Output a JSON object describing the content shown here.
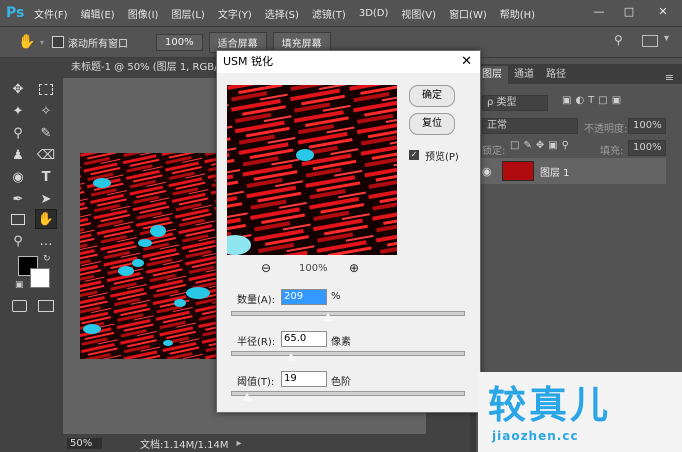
{
  "app": {
    "logo": "Ps",
    "menu": [
      "文件(F)",
      "编辑(E)",
      "图像(I)",
      "图层(L)",
      "文字(Y)",
      "选择(S)",
      "滤镜(T)",
      "3D(D)",
      "视图(V)",
      "窗口(W)",
      "帮助(H)"
    ],
    "window_controls": [
      "minimize-icon",
      "maximize-icon",
      "close-icon"
    ]
  },
  "options_bar": {
    "tool_icon": "hand-icon",
    "scroll_all_label": "滚动所有窗口",
    "scroll_all_checked": false,
    "zoom_btn": "100%",
    "fit_btn": "适合屏幕",
    "fill_btn": "填充屏幕"
  },
  "document": {
    "tab_title": "未标题-1 @ 50% (图层 1, RGB/8",
    "zoom": "50%",
    "doc_info": "文档:1.14M/1.14M"
  },
  "layers_panel": {
    "tabs": [
      "图层",
      "通道",
      "路径"
    ],
    "active_tab": "图层",
    "kind_filter": "ρ 类型",
    "blend_mode": "正常",
    "opacity_label": "不透明度:",
    "opacity_value": "100%",
    "lock_label": "锁定:",
    "fill_label": "填充:",
    "fill_value": "100%",
    "layers": [
      {
        "name": "图层 1",
        "visible": true
      }
    ]
  },
  "dialog": {
    "title": "USM 锐化",
    "ok_label": "确定",
    "reset_label": "复位",
    "preview_label": "预览(P)",
    "preview_checked": true,
    "zoom_label": "100%",
    "amount_label": "数量(A):",
    "amount_value": "209",
    "amount_unit": "%",
    "amount_fraction": 0.42,
    "radius_label": "半径(R):",
    "radius_value": "65.0",
    "radius_unit": "像素",
    "radius_fraction": 0.26,
    "threshold_label": "阈值(T):",
    "threshold_value": "19",
    "threshold_unit": "色阶",
    "threshold_fraction": 0.07
  },
  "watermark": {
    "main": "较真儿",
    "sub": "jiaozhen.cc"
  },
  "colors": {
    "accent": "#2aa6e6",
    "image_red": "#e0141a",
    "image_cyan": "#28c8e6"
  }
}
